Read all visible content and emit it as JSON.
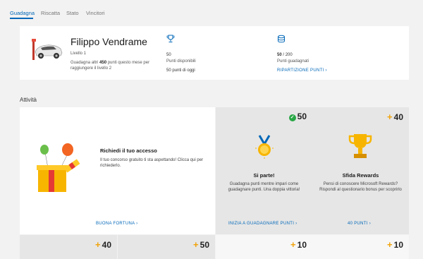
{
  "nav": {
    "items": [
      "Guadagna",
      "Riscatta",
      "Stato",
      "Vincitori"
    ]
  },
  "profile": {
    "name": "Filippo Vendrame",
    "level": "Livello 1",
    "goal_prefix": "Guadagna altri ",
    "goal_points": "450",
    "goal_suffix": " punti questo mese per raggiungere il livello 2"
  },
  "stats": {
    "available_value": "50",
    "available_label": "Punti disponibili",
    "today": "50 punti di oggi",
    "earned_value": "50",
    "earned_total": " / 200",
    "earned_label": "Punti guadagnati",
    "breakdown_link": "RIPARTIZIONE PUNTI"
  },
  "activity": {
    "title": "Attività"
  },
  "cards": {
    "main": {
      "title": "Richiedi il tuo accesso",
      "desc": "Il tuo concorso gratuito ti sta aspettando! Clicca qui per richiederlo.",
      "link": "BUONA FORTUNA"
    },
    "start": {
      "badge": "50",
      "title": "Si parte!",
      "desc": "Guadagna punti mentre impari come guadagnare punti. Una doppia vittoria!",
      "link": "INIZIA A GUADAGNARE PUNTI"
    },
    "rewards": {
      "badge": "40",
      "title": "Sfida Rewards",
      "desc": "Pensi di conoscere Microsoft Rewards? Rispondi al questionario bonus per scoprirlo",
      "link": "40 PUNTI"
    },
    "bottom": [
      "40",
      "50",
      "10",
      "10"
    ]
  },
  "colors": {
    "accent": "#0067b8",
    "plus": "#f0a30a",
    "check": "#28a745"
  }
}
